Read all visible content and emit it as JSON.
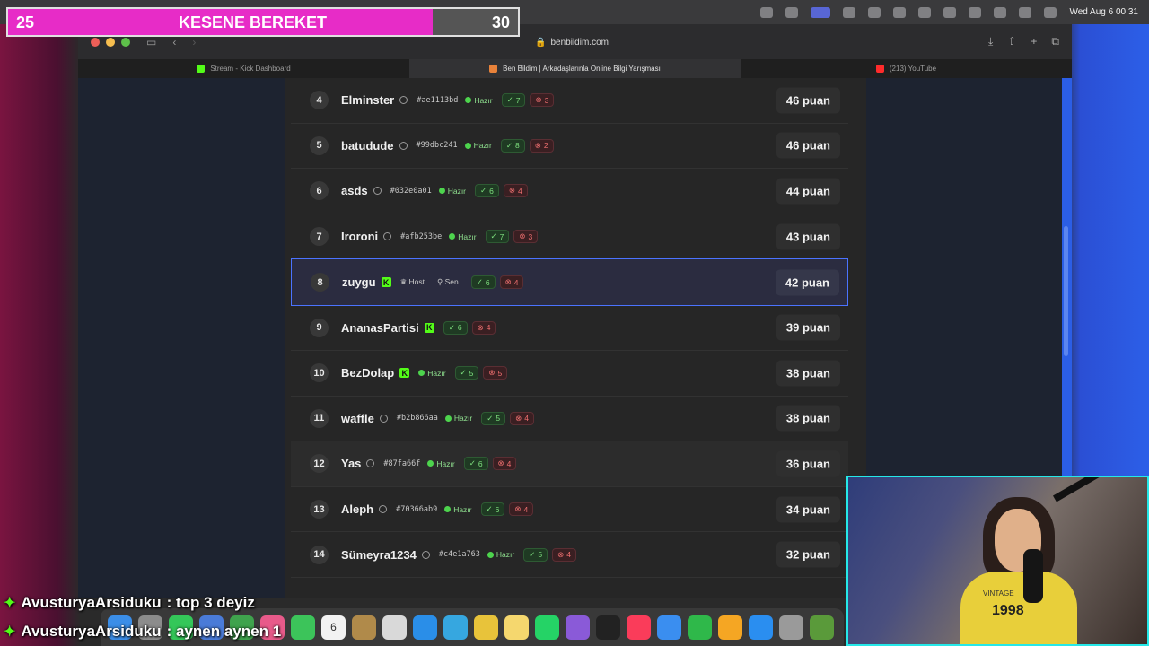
{
  "menubar": {
    "clock": "Wed Aug 6  00:31"
  },
  "browser": {
    "url": "benbildim.com",
    "tabs": [
      {
        "label": "Stream - Kick Dashboard",
        "fav": "kick"
      },
      {
        "label": "Ben Bildim | Arkadaşlarınla Online Bilgi Yarışması",
        "fav": "bb",
        "active": true
      },
      {
        "label": "(213) YouTube",
        "fav": "yt"
      }
    ]
  },
  "leaderboard": {
    "rows": [
      {
        "rank": "4",
        "name": "Elminster",
        "hash": "#ae1113bd",
        "status": "Hazır",
        "correct": "7",
        "wrong": "3",
        "points": "46 puan"
      },
      {
        "rank": "5",
        "name": "batudude",
        "hash": "#99dbc241",
        "status": "Hazır",
        "correct": "8",
        "wrong": "2",
        "points": "46 puan"
      },
      {
        "rank": "6",
        "name": "asds",
        "hash": "#032e0a01",
        "status": "Hazır",
        "correct": "6",
        "wrong": "4",
        "points": "44 puan"
      },
      {
        "rank": "7",
        "name": "Iroroni",
        "hash": "#afb253be",
        "status": "Hazır",
        "correct": "7",
        "wrong": "3",
        "points": "43 puan"
      },
      {
        "rank": "8",
        "name": "zuygu",
        "kick": true,
        "host": "Host",
        "you": "Sen",
        "correct": "6",
        "wrong": "4",
        "points": "42 puan",
        "highlight": true
      },
      {
        "rank": "9",
        "name": "AnanasPartisi",
        "kick": true,
        "correct": "6",
        "wrong": "4",
        "points": "39 puan"
      },
      {
        "rank": "10",
        "name": "BezDolap",
        "kick": true,
        "status": "Hazır",
        "correct": "5",
        "wrong": "5",
        "points": "38 puan"
      },
      {
        "rank": "11",
        "name": "waffle",
        "hash": "#b2b866aa",
        "status": "Hazır",
        "correct": "5",
        "wrong": "4",
        "points": "38 puan"
      },
      {
        "rank": "12",
        "name": "Yas",
        "hash": "#87fa66f",
        "status": "Hazır",
        "correct": "6",
        "wrong": "4",
        "points": "36 puan",
        "hover": true
      },
      {
        "rank": "13",
        "name": "Aleph",
        "hash": "#70366ab9",
        "status": "Hazır",
        "correct": "6",
        "wrong": "4",
        "points": "34 puan"
      },
      {
        "rank": "14",
        "name": "Sümeyra1234",
        "hash": "#c4e1a763",
        "status": "Hazır",
        "correct": "5",
        "wrong": "4",
        "points": "32 puan"
      }
    ]
  },
  "overlay": {
    "score_left": "25",
    "score_title": "KESENE BEREKET",
    "score_right": "30",
    "score_progress": 0.833,
    "chat": [
      {
        "user": "AvusturyaArsiduku",
        "message": " : top 3 deyiz"
      },
      {
        "user": "AvusturyaArsiduku",
        "message": " : aynen aynen 1"
      }
    ],
    "webcam_shirt": "1998",
    "webcam_shirt_top": "VINTAGE",
    "dock_calendar_day": "6"
  },
  "colors": {
    "kick_green": "#53fc18",
    "highlight_border": "#4b73ff",
    "score_fill": "#e72cc7",
    "webcam_border": "#25e8e8"
  }
}
